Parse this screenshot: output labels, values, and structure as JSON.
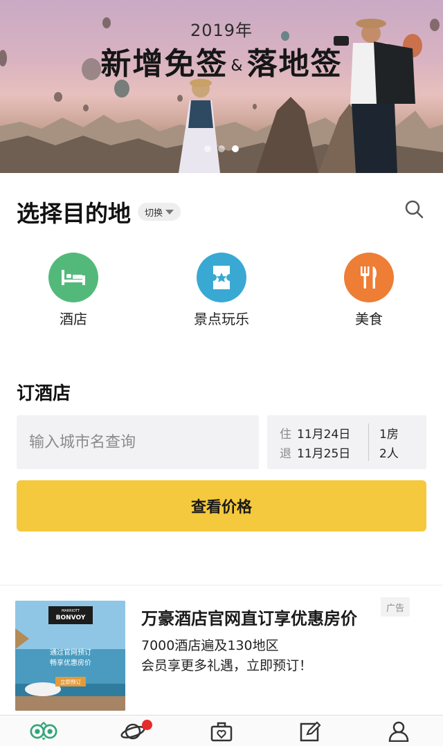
{
  "banner": {
    "year": "2019年",
    "title_part1": "新增免签",
    "title_amp": "&",
    "title_part2": "落地签",
    "active_slide": 2,
    "slide_count": 3
  },
  "destination": {
    "title": "选择目的地",
    "switch_label": "切换",
    "search_icon": "search-icon",
    "categories": [
      {
        "label": "酒店",
        "icon": "bed-icon",
        "color": "#53b97a"
      },
      {
        "label": "景点玩乐",
        "icon": "ticket-icon",
        "color": "#39a9d4"
      },
      {
        "label": "美食",
        "icon": "fork-knife-icon",
        "color": "#ee7d35"
      }
    ]
  },
  "booking": {
    "title": "订酒店",
    "city_placeholder": "输入城市名查询",
    "checkin_prefix": "住",
    "checkin_date": "11月24日",
    "checkout_prefix": "退",
    "checkout_date": "11月25日",
    "rooms": "1房",
    "guests": "2人",
    "submit_label": "查看价格",
    "accent_color": "#f5c93d"
  },
  "ad": {
    "title": "万豪酒店官网直订享优惠房价",
    "badge": "广告",
    "line1": "7000酒店遍及130地区",
    "line2": "会员享更多礼遇，立即预订！",
    "image": {
      "brand_top": "MARRIOTT",
      "brand": "BONVOY",
      "text1": "通过官网预订",
      "text2": "畅享优惠房价",
      "cta": "立即预订"
    }
  },
  "tabbar": {
    "items": [
      {
        "icon": "owl-logo-icon"
      },
      {
        "icon": "planet-icon"
      },
      {
        "icon": "suitcase-heart-icon"
      },
      {
        "icon": "pencil-square-icon"
      },
      {
        "icon": "person-icon"
      }
    ],
    "notification_dot_color": "#e82a2a"
  }
}
